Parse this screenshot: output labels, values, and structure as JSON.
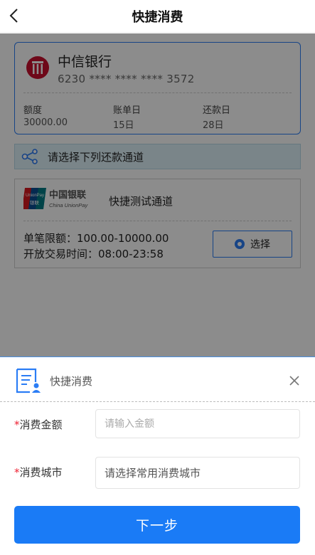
{
  "header": {
    "title": "快捷消费"
  },
  "card": {
    "bank_name": "中信银行",
    "card_number": "6230 **** **** **** 3572",
    "columns": [
      {
        "label": "额度",
        "value": "30000.00"
      },
      {
        "label": "账单日",
        "value": "15日"
      },
      {
        "label": "还款日",
        "value": "28日"
      }
    ]
  },
  "section": {
    "text": "请选择下列还款通道"
  },
  "channel": {
    "logo": {
      "cn": "中国银联",
      "en": "China UnionPay",
      "badge_top": "UnionPay",
      "badge_bottom": "银联"
    },
    "name": "快捷测试通道",
    "limit": "单笔限额：100.00-10000.00",
    "time": "开放交易时间：08:00-23:58",
    "select_label": "选择"
  },
  "sheet": {
    "title": "快捷消费",
    "amount": {
      "label": "消费金额",
      "required_mark": "*",
      "placeholder": "请输入金额",
      "value": ""
    },
    "city": {
      "label": "消费城市",
      "required_mark": "*",
      "placeholder": "请选择常用消费城市",
      "value": ""
    },
    "next_label": "下一步"
  },
  "colors": {
    "accent": "#1a7bf6",
    "bank_red": "#c8102e",
    "required": "#e22233"
  },
  "icons": [
    "back-icon",
    "citic-bank-logo",
    "share-icon",
    "unionpay-logo",
    "radio-icon",
    "form-document-icon",
    "close-icon"
  ]
}
